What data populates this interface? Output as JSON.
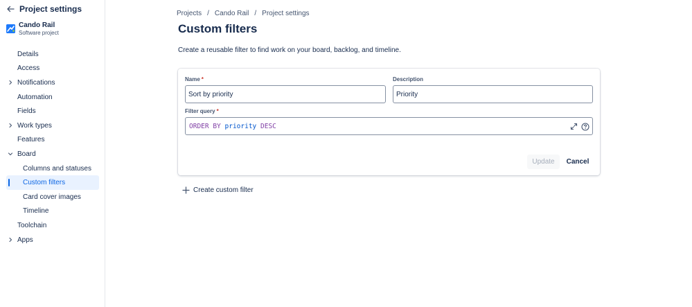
{
  "sidebar": {
    "title": "Project settings",
    "project": {
      "name": "Cando Rail",
      "type": "Software project"
    },
    "items": [
      {
        "label": "Details",
        "chevron": ""
      },
      {
        "label": "Access",
        "chevron": ""
      },
      {
        "label": "Notifications",
        "chevron": "right"
      },
      {
        "label": "Automation",
        "chevron": ""
      },
      {
        "label": "Fields",
        "chevron": ""
      },
      {
        "label": "Work types",
        "chevron": "right"
      },
      {
        "label": "Features",
        "chevron": ""
      },
      {
        "label": "Board",
        "chevron": "down"
      },
      {
        "label": "Columns and statuses",
        "sub": true
      },
      {
        "label": "Custom filters",
        "sub": true,
        "active": true
      },
      {
        "label": "Card cover images",
        "sub": true
      },
      {
        "label": "Timeline",
        "sub": true
      },
      {
        "label": "Toolchain",
        "chevron": ""
      },
      {
        "label": "Apps",
        "chevron": "right"
      }
    ]
  },
  "breadcrumb": [
    "Projects",
    "Cando Rail",
    "Project settings"
  ],
  "page": {
    "title": "Custom filters",
    "description": "Create a reusable filter to find work on your board, backlog, and timeline."
  },
  "form": {
    "name_label": "Name",
    "name_value": "Sort by priority",
    "description_label": "Description",
    "description_value": "Priority",
    "query_label": "Filter query",
    "required_mark": "*",
    "query": {
      "kw1": "ORDER BY",
      "field": "priority",
      "kw2": "DESC"
    },
    "update_label": "Update",
    "cancel_label": "Cancel"
  },
  "create_label": "Create custom filter",
  "colors": {
    "accent": "#0c66e4",
    "active_bg": "#e9f2ff",
    "required": "#c9372c",
    "keyword": "#803fa5",
    "identifier": "#0055cc"
  },
  "icons": [
    "arrow-left-icon",
    "project-avatar-icon",
    "chevron-right-icon",
    "chevron-down-icon",
    "expand-icon",
    "help-icon",
    "plus-icon"
  ]
}
